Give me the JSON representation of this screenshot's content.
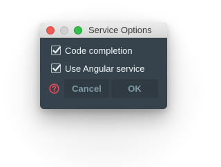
{
  "window": {
    "title": "Service Options"
  },
  "options": [
    {
      "label": "Code completion",
      "checked": true
    },
    {
      "label": "Use Angular service",
      "checked": true
    }
  ],
  "buttons": {
    "cancel_label": "Cancel",
    "ok_label": "OK"
  },
  "icons": {
    "help": "question-circle-icon"
  },
  "colors": {
    "dialog_background": "#37434c",
    "button_background": "#2f3a42",
    "button_text": "#7f9aa6",
    "help_icon": "#e8525f",
    "close_light": "#ee5c56",
    "zoom_light": "#2fbf4a"
  }
}
